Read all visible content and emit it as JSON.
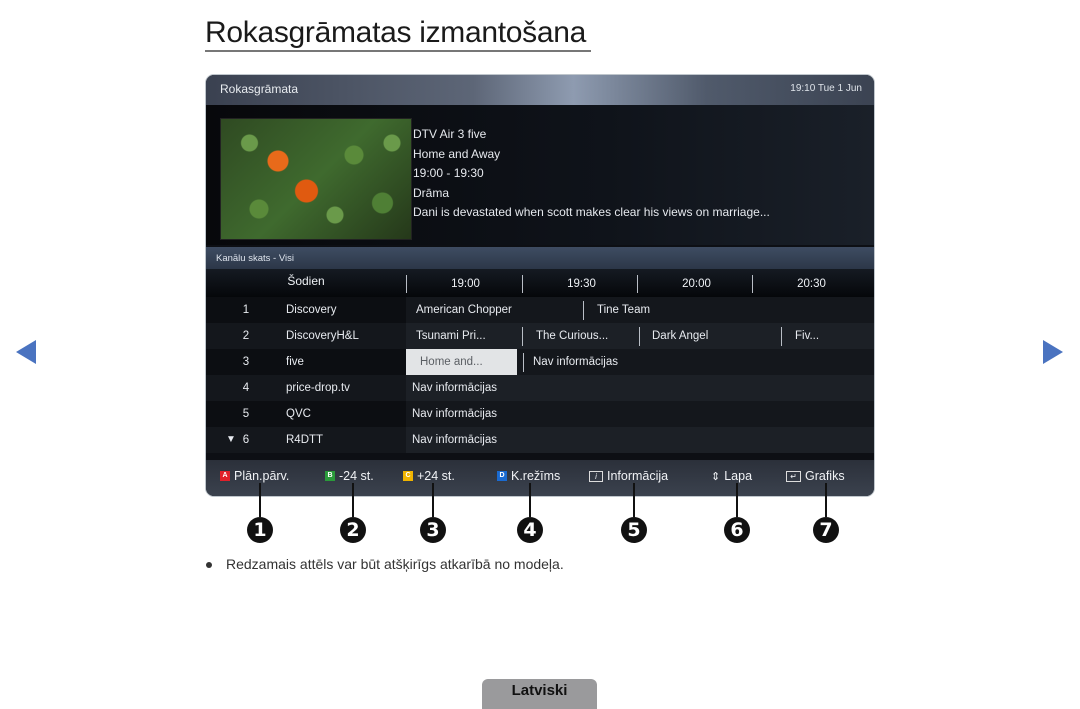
{
  "page": {
    "title": "Rokasgrāmatas izmantošana",
    "note": "Redzamais attēls var būt atšķirīgs atkarībā no modeļa.",
    "language_tab": "Latviski",
    "nav": {
      "prev_icon": "triangle-left",
      "next_icon": "triangle-right",
      "color": "#4a73c0"
    }
  },
  "guide": {
    "header_title": "Rokasgrāmata",
    "datetime": "19:10 Tue 1 Jun",
    "info": {
      "channel": "DTV Air 3 five",
      "program": "Home and Away",
      "time": "19:00 - 19:30",
      "genre": "Drāma",
      "description": "Dani is devastated when scott makes clear his views on marriage..."
    },
    "view_label": "Kanālu skats - Visi",
    "today_label": "Šodien",
    "time_slots": [
      "19:00",
      "19:30",
      "20:00",
      "20:30"
    ],
    "channels": [
      {
        "num": "1",
        "name": "Discovery",
        "programs": [
          "American Chopper",
          "Tine Team"
        ]
      },
      {
        "num": "2",
        "name": "DiscoveryH&L",
        "programs": [
          "Tsunami Pri...",
          "The Curious...",
          "Dark Angel",
          "Fiv..."
        ]
      },
      {
        "num": "3",
        "name": "five",
        "programs": [
          "Home and...",
          "Nav informācijas"
        ],
        "selected": "Home and..."
      },
      {
        "num": "4",
        "name": "price-drop.tv",
        "programs": [
          "Nav informācijas"
        ]
      },
      {
        "num": "5",
        "name": "QVC",
        "programs": [
          "Nav informācijas"
        ]
      },
      {
        "num": "6",
        "name": "R4DTT",
        "programs": [
          "Nav informācijas"
        ],
        "arrow": "▼"
      }
    ],
    "footer": [
      {
        "key": "A",
        "key_color": "#e0202a",
        "label": "Plān.pārv.",
        "callout": "1"
      },
      {
        "key": "B",
        "key_color": "#2a9a3a",
        "label": "-24 st.",
        "callout": "2"
      },
      {
        "key": "C",
        "key_color": "#f0b400",
        "label": "+24 st.",
        "callout": "3"
      },
      {
        "key": "D",
        "key_color": "#1a6ad0",
        "label": "K.režīms",
        "callout": "4"
      },
      {
        "icon": "info-icon",
        "label": "Informācija",
        "callout": "5"
      },
      {
        "icon": "page-updown-icon",
        "label": "Lapa",
        "callout": "6"
      },
      {
        "icon": "schedule-icon",
        "label": "Grafiks",
        "callout": "7"
      }
    ]
  }
}
